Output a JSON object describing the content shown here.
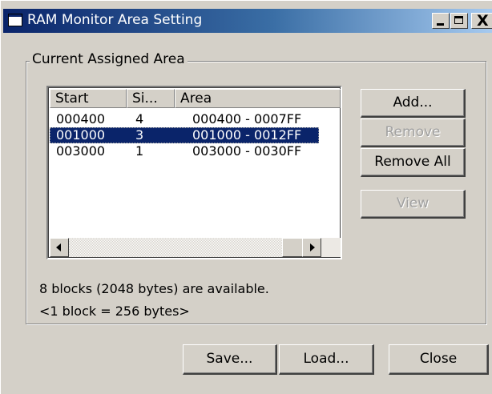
{
  "window": {
    "title": "RAM Monitor Area Setting",
    "title_bar_color": "#0a246a",
    "buttons": [
      "minimize-icon",
      "maximize-icon",
      "close-icon"
    ]
  },
  "group": {
    "label": "Current Assigned Area"
  },
  "list": {
    "columns": [
      "Start",
      "Si...",
      "Area"
    ],
    "rows": [
      {
        "start": "000400",
        "size": "4",
        "area": "000400 - 0007FF",
        "selected": false
      },
      {
        "start": "001000",
        "size": "3",
        "area": "001000 - 0012FF",
        "selected": true
      },
      {
        "start": "003000",
        "size": "1",
        "area": "003000 - 0030FF",
        "selected": false
      }
    ],
    "selection_color": "#0a246a"
  },
  "side_buttons": {
    "add": "Add...",
    "remove": "Remove",
    "remove_all": "Remove All",
    "view": "View"
  },
  "info": {
    "available": "8 blocks (2048 bytes) are available.",
    "block_size": "<1 block = 256 bytes>"
  },
  "bottom_buttons": {
    "save": "Save...",
    "load": "Load...",
    "close": "Close"
  },
  "close_glyph": "X"
}
